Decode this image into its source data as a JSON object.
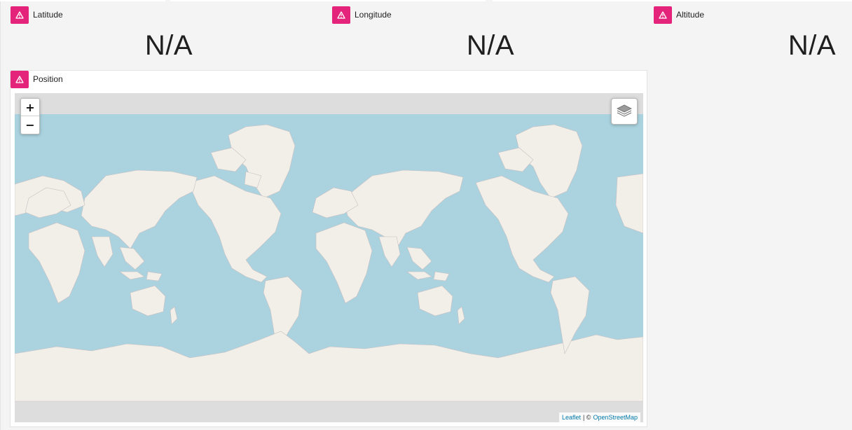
{
  "cards": {
    "latitude": {
      "title": "Latitude",
      "value": "N/A"
    },
    "longitude": {
      "title": "Longitude",
      "value": "N/A"
    },
    "altitude": {
      "title": "Altitude",
      "value": "N/A"
    },
    "position": {
      "title": "Position"
    }
  },
  "map": {
    "zoom_in_label": "+",
    "zoom_out_label": "−",
    "attribution": {
      "leaflet": "Leaflet",
      "separator": "| ©",
      "osm": "OpenStreetMap"
    }
  },
  "colors": {
    "alert_badge": "#e4247a",
    "ocean": "#aad3df",
    "land": "#f2efe9",
    "map_grey": "#dddddd"
  },
  "icons": {
    "card_badge": "warning-triangle-icon",
    "layers": "layers-icon"
  }
}
